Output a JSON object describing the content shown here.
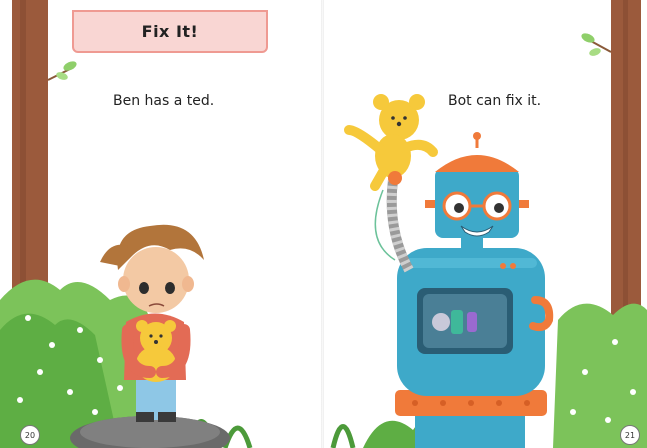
{
  "book": {
    "title": "Fix It!",
    "left_page": {
      "text": "Ben has a ted.",
      "page_number": "20"
    },
    "right_page": {
      "text": "Bot can fix it.",
      "page_number": "21"
    }
  },
  "colors": {
    "title_box_fill": "#f9d6d3",
    "title_box_border": "#ef9a92",
    "robot_body": "#3ea9c9",
    "robot_accent": "#f07a3a",
    "teddy": "#f6c93b",
    "foliage": "#7cc35a"
  }
}
